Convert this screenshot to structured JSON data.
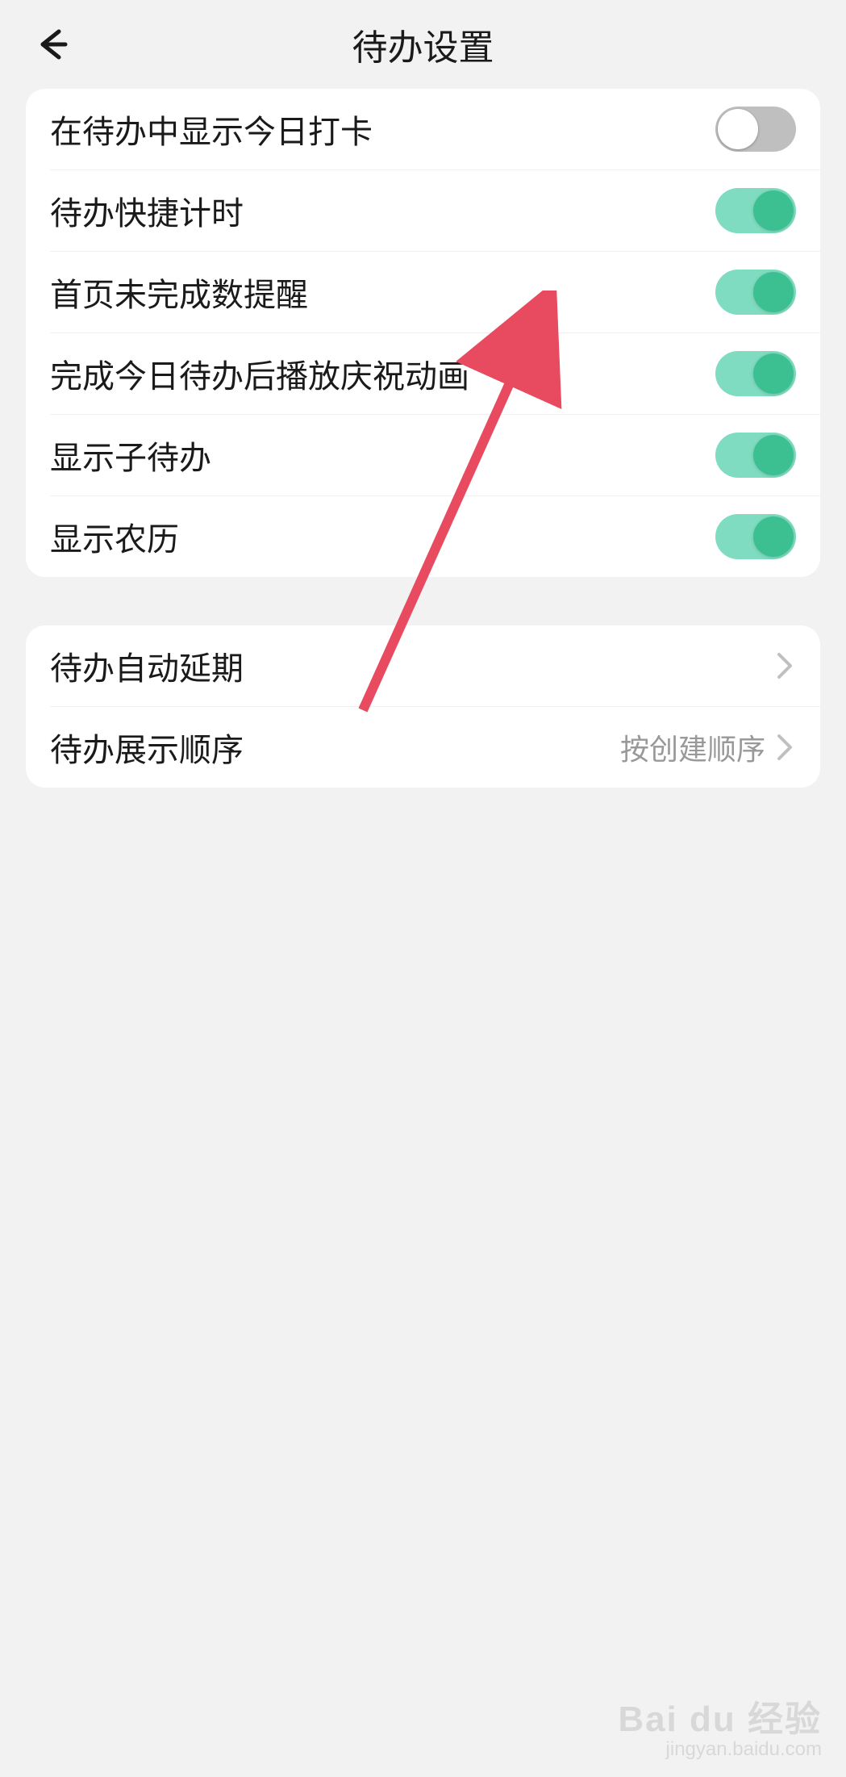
{
  "header": {
    "title": "待办设置"
  },
  "section1": {
    "items": [
      {
        "label": "在待办中显示今日打卡",
        "on": false
      },
      {
        "label": "待办快捷计时",
        "on": true
      },
      {
        "label": "首页未完成数提醒",
        "on": true
      },
      {
        "label": "完成今日待办后播放庆祝动画",
        "on": true
      },
      {
        "label": "显示子待办",
        "on": true
      },
      {
        "label": "显示农历",
        "on": true
      }
    ]
  },
  "section2": {
    "items": [
      {
        "label": "待办自动延期",
        "value": ""
      },
      {
        "label": "待办展示顺序",
        "value": "按创建顺序"
      }
    ]
  },
  "watermark": {
    "line1": "Bai du 经验",
    "line2": "jingyan.baidu.com"
  }
}
